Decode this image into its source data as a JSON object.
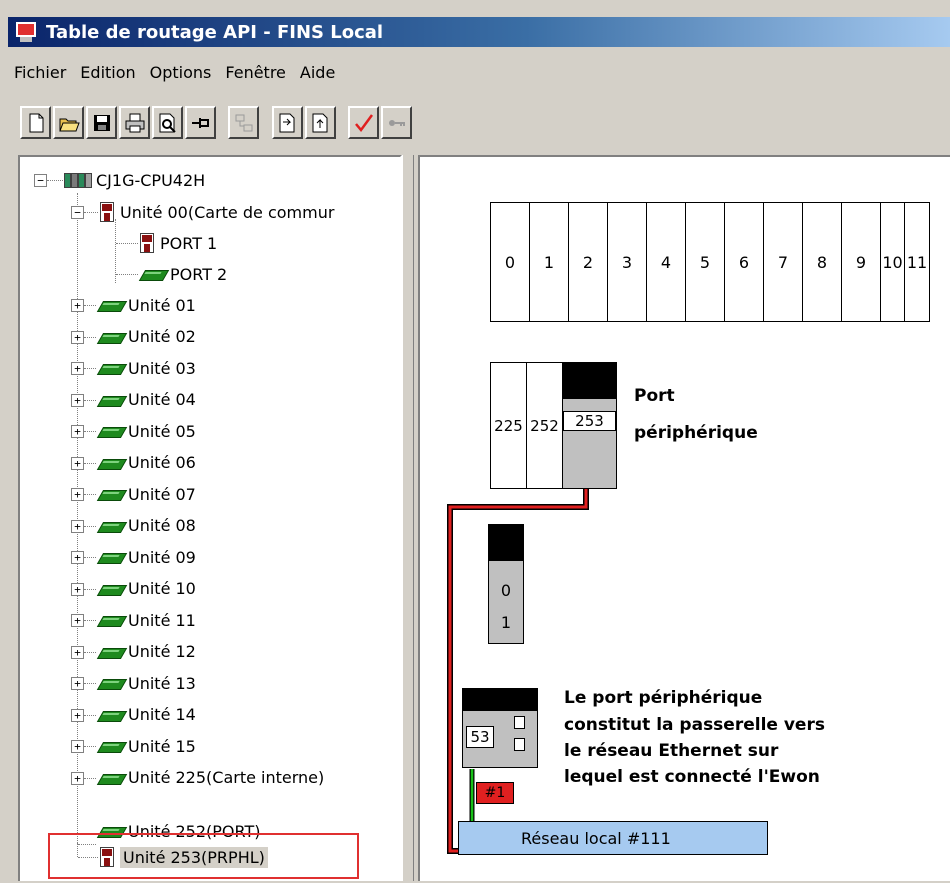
{
  "window": {
    "title": "Table de routage API - FINS Local"
  },
  "menu": [
    {
      "label": "Fichier"
    },
    {
      "label": "Edition"
    },
    {
      "label": "Options"
    },
    {
      "label": "Fenêtre"
    },
    {
      "label": "Aide"
    }
  ],
  "toolbar": [
    "new-icon",
    "open-icon",
    "save-icon",
    "print-icon",
    "preview-icon",
    "pin-icon",
    "connect-icon",
    "import-icon",
    "export-icon",
    "check-icon",
    "key-icon"
  ],
  "tree": {
    "root": "CJ1G-CPU42H",
    "unit00": "Unité 00(Carte de commur",
    "port1": "PORT 1",
    "port2": "PORT 2",
    "units": [
      "Unité 01",
      "Unité 02",
      "Unité 03",
      "Unité 04",
      "Unité 05",
      "Unité 06",
      "Unité 07",
      "Unité 08",
      "Unité 09",
      "Unité 10",
      "Unité 11",
      "Unité 12",
      "Unité 13",
      "Unité 14",
      "Unité 15",
      "Unité 225(Carte interne)"
    ],
    "unit252": "Unité 252(PORT)",
    "unit253": "Unité 253(PRPHL)"
  },
  "diagram": {
    "slots": [
      "0",
      "1",
      "2",
      "3",
      "4",
      "5",
      "6",
      "7",
      "8",
      "9",
      "10",
      "11"
    ],
    "rack": [
      "225",
      "252",
      "253"
    ],
    "port_label_1": "Port",
    "port_label_2": "périphérique",
    "module_values": [
      "0",
      "1"
    ],
    "module_unit": "53",
    "node_badge": "#1",
    "note": [
      "Le port périphérique",
      "constitut la passerelle vers",
      "le réseau Ethernet sur",
      "lequel est connecté l'Ewon"
    ],
    "network": "Réseau local #111",
    "colors": {
      "link_red": "#e02020",
      "link_black": "#000000",
      "link_green": "#18c018",
      "network": "#a6caf0"
    }
  }
}
